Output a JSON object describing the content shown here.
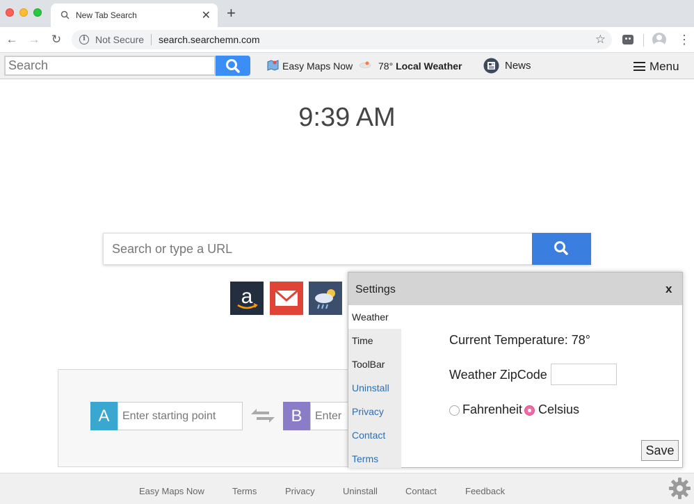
{
  "browser": {
    "tab_title": "New Tab Search",
    "tab_close": "✕",
    "new_tab": "+",
    "security_label": "Not Secure",
    "url": "search.searchemn.com"
  },
  "page_toolbar": {
    "search_placeholder": "Search",
    "maps_label": "Easy Maps Now",
    "weather_temp": "78°",
    "weather_label": "Local Weather",
    "news_label": "News",
    "menu_label": "Menu"
  },
  "clock": "9:39 AM",
  "main_search": {
    "placeholder": "Search or type a URL"
  },
  "shortcuts": [
    "amazon",
    "gmail",
    "weather"
  ],
  "maps_widget": {
    "badge_a": "A",
    "badge_b": "B",
    "start_placeholder": "Enter starting point",
    "end_placeholder": "Enter destination"
  },
  "settings": {
    "title": "Settings",
    "close": "x",
    "nav": [
      "Weather",
      "Time",
      "ToolBar",
      "Uninstall",
      "Privacy",
      "Contact",
      "Terms"
    ],
    "current_temperature": "Current Temperature: 78°",
    "zip_label": "Weather ZipCode",
    "fahrenheit": "Fahrenheit",
    "celsius": "Celsius",
    "selected_unit": "Celsius",
    "save": "Save"
  },
  "footer": {
    "links": [
      "Easy Maps Now",
      "Terms",
      "Privacy",
      "Uninstall",
      "Contact",
      "Feedback"
    ]
  },
  "colors": {
    "search_blue": "#3a7ee0",
    "badge_a": "#3aa7d0",
    "badge_b": "#8b7cc8",
    "radio_selected": "#f06aa8",
    "link_blue": "#2a6fb5"
  }
}
